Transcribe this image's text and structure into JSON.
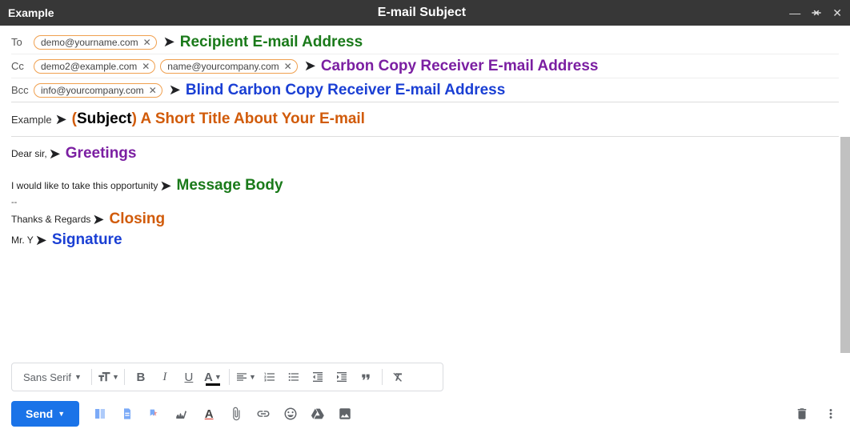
{
  "titlebar": {
    "left": "Example",
    "center": "E-mail Subject"
  },
  "fields": {
    "to_label": "To",
    "cc_label": "Cc",
    "bcc_label": "Bcc",
    "to_chips": [
      "demo@yourname.com"
    ],
    "cc_chips": [
      "demo2@example.com",
      "name@yourcompany.com"
    ],
    "bcc_chips": [
      "info@yourcompany.com"
    ]
  },
  "annotations": {
    "to": "Recipient E-mail Address",
    "cc": "Carbon Copy Receiver E-mail Address",
    "bcc": "Blind Carbon Copy Receiver E-mail Address",
    "subject_prefix": "(Subject)",
    "subject_rest": " A Short Title About Your E-mail",
    "greetings": "Greetings",
    "body": "Message Body",
    "closing": "Closing",
    "signature": "Signature"
  },
  "subject": {
    "value": "Example"
  },
  "body": {
    "greeting": "Dear sir,",
    "line1": "I would like to take this opportunity",
    "sep": "--",
    "closing": "Thanks & Regards",
    "signature": "Mr. Y"
  },
  "toolbar": {
    "font": "Sans Serif"
  },
  "send": {
    "label": "Send"
  }
}
